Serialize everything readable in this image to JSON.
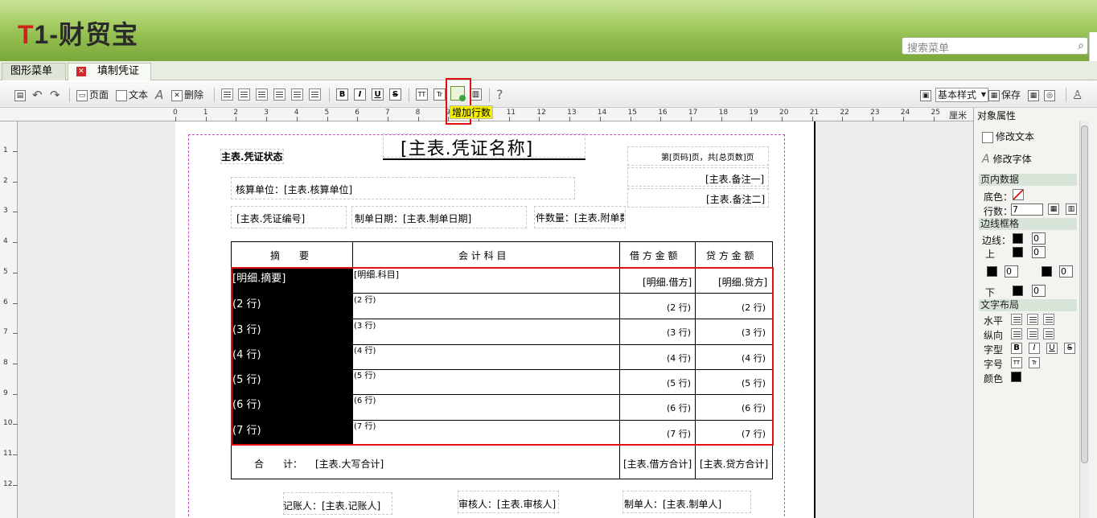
{
  "app": {
    "brand_t": "T",
    "brand_rest": "1-财贸宝",
    "search_placeholder": "搜索菜单"
  },
  "tabs": [
    {
      "label": "图形菜单"
    },
    {
      "label": "填制凭证",
      "close": "✕"
    }
  ],
  "toolbar": {
    "page": "页面",
    "text": "文本",
    "delete": "删除",
    "bold": "B",
    "italic": "I",
    "underline": "U",
    "strike": "S",
    "font_a": "TT",
    "font_b": "Tr",
    "help": "?",
    "style_select": "基本样式",
    "save": "保存",
    "tooltip": "增加行数"
  },
  "ruler": {
    "unit": "厘米",
    "h_marks": [
      "0",
      "1",
      "2",
      "3",
      "4",
      "5",
      "6",
      "7",
      "8",
      "9",
      "10",
      "11",
      "12",
      "13",
      "14",
      "15",
      "16",
      "17",
      "18",
      "19",
      "20",
      "21",
      "22",
      "23",
      "24",
      "25"
    ],
    "v_marks": [
      "1",
      "2",
      "3",
      "4",
      "5",
      "6",
      "7",
      "8",
      "9",
      "10",
      "11",
      "12"
    ]
  },
  "voucher": {
    "status": "主表.凭证状态",
    "title": "[主表.凭证名称]",
    "page_info": "第[页码]页，共[总页数]页",
    "note1": "[主表.备注一]",
    "note2": "[主表.备注二]",
    "unit": "核算单位：[主表.核算单位]",
    "number": "[主表.凭证编号]",
    "date": "制单日期：[主表.制单日期]",
    "attach": "件数量：[主表.附单数",
    "headers": [
      "摘　　要",
      "会 计 科 目",
      "借 方 金 额",
      "贷 方 金 额"
    ],
    "rows": [
      {
        "summary": "[明细.摘要]",
        "account": "[明细.科目]",
        "debit": "[明细.借方]",
        "credit": "[明细.贷方]"
      },
      {
        "summary": "(2 行)",
        "account": "(2 行)",
        "debit": "(2 行)",
        "credit": "(2 行)"
      },
      {
        "summary": "(3 行)",
        "account": "(3 行)",
        "debit": "(3 行)",
        "credit": "(3 行)"
      },
      {
        "summary": "(4 行)",
        "account": "(4 行)",
        "debit": "(4 行)",
        "credit": "(4 行)"
      },
      {
        "summary": "(5 行)",
        "account": "(5 行)",
        "debit": "(5 行)",
        "credit": "(5 行)"
      },
      {
        "summary": "(6 行)",
        "account": "(6 行)",
        "debit": "(6 行)",
        "credit": "(6 行)"
      },
      {
        "summary": "(7 行)",
        "account": "(7 行)",
        "debit": "(7 行)",
        "credit": "(7 行)"
      }
    ],
    "total_label": "合　　计：",
    "total_upper": "[主表.大写合计]",
    "total_debit": "[主表.借方合计]",
    "total_credit": "[主表.贷方合计]",
    "bookkeeper": "记账人：[主表.记账人]",
    "auditor": "审核人：[主表.审核人]",
    "maker": "制单人：[主表.制单人]"
  },
  "props": {
    "title": "对象属性",
    "modify_text": "修改文本",
    "modify_font": "修改字体",
    "page_data": "页内数据",
    "bg_color": "底色：",
    "rows_label": "行数：",
    "rows_value": "7",
    "border_section": "边线框格",
    "border": "边线：",
    "top": "上",
    "bottom": "下",
    "zero": "0",
    "layout_section": "文字布局",
    "horizontal": "水平",
    "vertical": "纵向",
    "font_type": "字型",
    "font_size": "字号",
    "color": "颜色"
  }
}
